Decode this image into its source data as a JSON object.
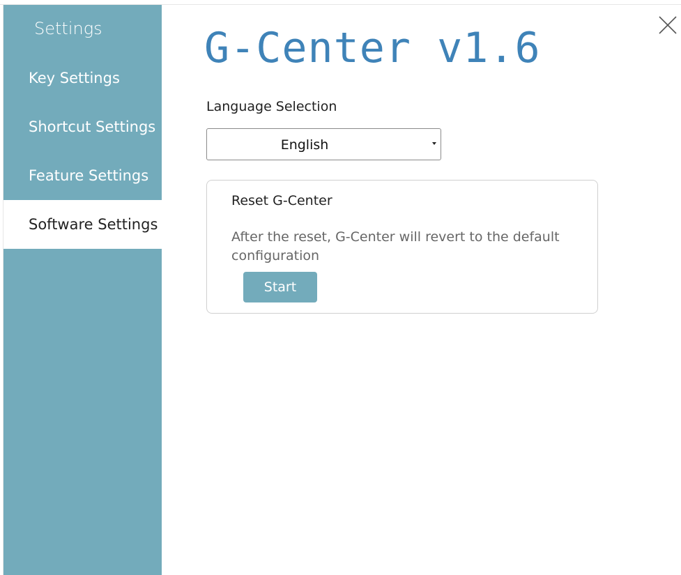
{
  "sidebar": {
    "title": "Settings",
    "items": [
      {
        "label": "Key Settings",
        "active": false
      },
      {
        "label": "Shortcut Settings",
        "active": false
      },
      {
        "label": "Feature Settings",
        "active": false
      },
      {
        "label": "Software Settings",
        "active": true
      }
    ]
  },
  "window": {
    "close_icon": "close-icon"
  },
  "main": {
    "app_title": "G-Center v1.6",
    "language": {
      "label": "Language Selection",
      "selected": "English"
    },
    "reset": {
      "title": "Reset G-Center",
      "description": "After the reset, G-Center will revert to the default configuration",
      "button_label": "Start"
    }
  },
  "colors": {
    "sidebar_bg": "#73abbb",
    "title_color": "#3f83b8",
    "button_bg": "#73abbb"
  }
}
